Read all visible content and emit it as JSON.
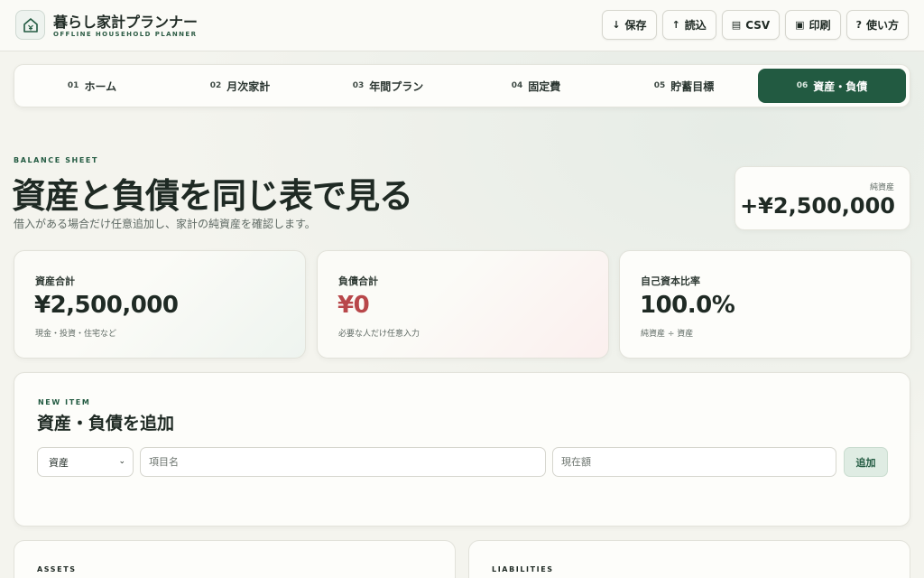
{
  "app": {
    "title": "暮らし家計プランナー",
    "subtitle": "OFFLINE HOUSEHOLD PLANNER",
    "logo_icon": "house-yen-icon"
  },
  "toolbar": {
    "save": {
      "icon": "↓",
      "label": "保存"
    },
    "load": {
      "icon": "↑",
      "label": "読込"
    },
    "csv": {
      "icon": "▤",
      "label": "CSV"
    },
    "print": {
      "icon": "▣",
      "label": "印刷"
    },
    "help": {
      "icon": "?",
      "label": "使い方"
    }
  },
  "tabs": [
    {
      "num": "01",
      "label": "ホーム"
    },
    {
      "num": "02",
      "label": "月次家計"
    },
    {
      "num": "03",
      "label": "年間プラン"
    },
    {
      "num": "04",
      "label": "固定費"
    },
    {
      "num": "05",
      "label": "貯蓄目標"
    },
    {
      "num": "06",
      "label": "資産・負債",
      "active": true
    }
  ],
  "header": {
    "kicker": "BALANCE SHEET",
    "title": "資産と負債を同じ表で見る",
    "description": "借入がある場合だけ任意追加し、家計の純資産を確認します。"
  },
  "net_worth": {
    "label": "純資産",
    "value": "+¥2,500,000"
  },
  "stats": {
    "assets": {
      "label": "資産合計",
      "value": "¥2,500,000",
      "note": "現金・投資・住宅など"
    },
    "liabilities": {
      "label": "負債合計",
      "value": "¥0",
      "note": "必要な人だけ任意入力"
    },
    "equity_ratio": {
      "label": "自己資本比率",
      "value": "100.0%",
      "note": "純資産 ÷ 資産"
    }
  },
  "add_form": {
    "kicker": "NEW ITEM",
    "title": "資産・負債を追加",
    "type_selected": "資産",
    "name_placeholder": "項目名",
    "amount_placeholder": "現在額",
    "add_label": "追加"
  },
  "lists": {
    "assets_kicker": "ASSETS",
    "liabilities_kicker": "LIABILITIES"
  },
  "colors": {
    "accent": "#225a41",
    "debt": "#b8474a",
    "background": "#f4f4ee"
  }
}
